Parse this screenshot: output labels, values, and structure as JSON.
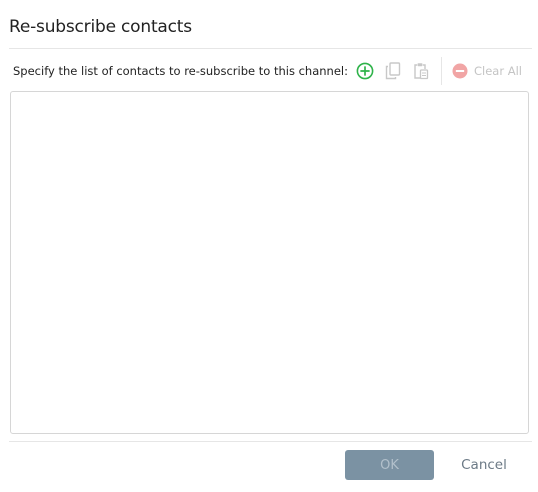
{
  "dialog": {
    "title": "Re-subscribe contacts",
    "instruction": "Specify the list of contacts to re-subscribe to this channel:"
  },
  "toolbar": {
    "add_icon": "add-circle-icon",
    "copy_icon": "copy-icon",
    "paste_icon": "paste-icon",
    "clear_all_icon": "minus-circle-icon",
    "clear_all_label": "Clear All"
  },
  "contact_list": {
    "items": []
  },
  "footer": {
    "ok_label": "OK",
    "cancel_label": "Cancel"
  },
  "colors": {
    "add_icon": "#2fb34a",
    "disabled_icon": "#c8c8c8",
    "clear_all_icon": "#f1a5a5",
    "ok_button_bg": "#7b92a3",
    "ok_button_text": "#b2c0cb",
    "cancel_text": "#6c7a86"
  }
}
